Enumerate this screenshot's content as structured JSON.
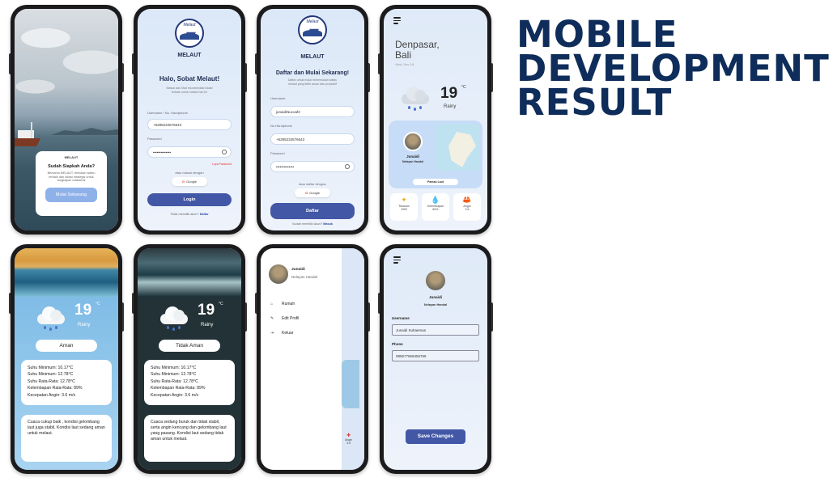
{
  "heading": {
    "line1": "MOBILE",
    "line2": "DEVELOPMENT",
    "line3": "RESULT"
  },
  "welcome": {
    "brand": "MELAUT",
    "title": "Sudah Siapkah Anda?",
    "text": "Bersama MELAUT, temukan waktu terbaik dan lokasi strategis untuk tangkapan maksimal",
    "button": "Mulai Sekarang"
  },
  "login": {
    "logo_caption": "Melaut",
    "brand": "MELAUT",
    "title": "Halo, Sobat Melaut!",
    "subtitle": "Masuk dan lihat rekomendasi lokasi terbaik untuk melaut hari ini",
    "username_label": "Username / No. Handphone",
    "username_value": "+6285234576643",
    "password_label": "Password",
    "password_value": "••••••••••••••",
    "forgot": "Lupa Password",
    "or_text": "atau masuk dengan",
    "google": "Google",
    "button": "Login",
    "bottom_text": "Tidak memiliki akun?",
    "bottom_link": "Daftar"
  },
  "register": {
    "logo_caption": "Melaut",
    "brand": "MELAUT",
    "title": "Daftar dan Mulai Sekarang!",
    "subtitle": "Daftar untuk mulai menemukan waktu melaut yang lebih aman dan produktif",
    "username_label": "Username",
    "username_value": "junaidiNucoaf2",
    "phone_label": "No Handphone",
    "phone_value": "+6285234576643",
    "password_label": "Password",
    "password_value": "••••••••••••••",
    "or_text": "atau daftar dengan",
    "google": "Google",
    "button": "Daftar",
    "bottom_text": "Sudah memiliki akun?",
    "bottom_link": "Masuk"
  },
  "home": {
    "city": "Denpasar,",
    "region": "Bali",
    "date": "Wed, Dec 18",
    "temp": "19",
    "deg": "°C",
    "condition": "Rainy",
    "user_name": "Junaidi",
    "user_role": "Nelayan Handal",
    "map_button": "Pantau Laut",
    "stats": [
      {
        "icon": "✦",
        "label": "Tekanan",
        "value": "1002"
      },
      {
        "icon": "💧",
        "label": "Kelembapan",
        "value": "84%"
      },
      {
        "icon": "🦀",
        "label": "Angin",
        "value": "3.6"
      }
    ]
  },
  "safe": {
    "temp": "19",
    "deg": "°C",
    "condition": "Rainy",
    "status": "Aman",
    "stats": [
      "Suhu Minimum: 10.17°C",
      "Suhu Minimum: 12.78°C",
      "Suhu Rata-Rata: 12.78°C",
      "Kelembapan Rata-Rata: 89%",
      "Kecepatan Angin: 3.6 m/s"
    ],
    "description": "Cuaca cukup baik , kondisi gelombang laut juga stabil. Kondisi laut sedang aman untuk melaut."
  },
  "unsafe": {
    "temp": "19",
    "deg": "°C",
    "condition": "Rainy",
    "status": "Tidak Aman",
    "stats": [
      "Suhu Minimum: 10.17°C",
      "Suhu Minimum: 12.78°C",
      "Suhu Rata-Rata: 12.78°C",
      "Kelembapan Rata-Rata: 89%",
      "Kecepatan Angin: 3.6 m/s"
    ],
    "description": "Cuaca sedang buruk dan tidak stabil, serta angin kencang dan gelombang laut yang pasang. Kondisi laut sedang tidak aman untuk melaut."
  },
  "drawer": {
    "name": "Junaidi",
    "role": "Nelayan Handal",
    "items": [
      "Rumah",
      "Edit Profil",
      "Keluar"
    ],
    "peek_label": "Angin",
    "peek_value": "3.6"
  },
  "edit": {
    "name": "Junaidi",
    "role": "Nelayan Handal",
    "username_label": "Username",
    "username_value": "Junaidi Suhaeman",
    "phone_label": "Phone",
    "phone_value": "085677659456765",
    "button": "Save Changes"
  },
  "colors": {
    "primary": "#4257a6",
    "heading": "#0f2d5a",
    "light_blue": "#8fb1ea"
  }
}
